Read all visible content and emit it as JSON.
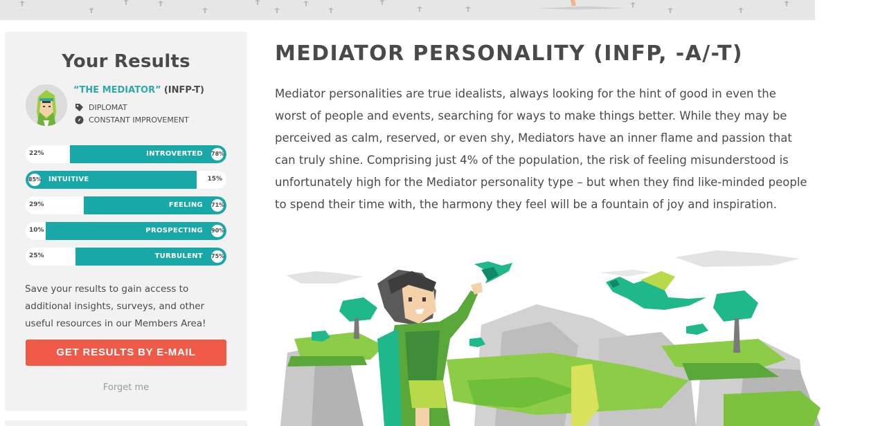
{
  "sidebar": {
    "title": "Your Results",
    "type_name": "“THE MEDIATOR”",
    "type_code": "(INFP-T)",
    "role": "DIPLOMAT",
    "strategy": "CONSTANT IMPROVEMENT",
    "traits": [
      {
        "label": "INTROVERTED",
        "dominant_pct": "78%",
        "other_pct": "22%",
        "dominant_value": 78,
        "side": "right"
      },
      {
        "label": "INTUITIVE",
        "dominant_pct": "85%",
        "other_pct": "15%",
        "dominant_value": 85,
        "side": "left"
      },
      {
        "label": "FEELING",
        "dominant_pct": "71%",
        "other_pct": "29%",
        "dominant_value": 71,
        "side": "right"
      },
      {
        "label": "PROSPECTING",
        "dominant_pct": "90%",
        "other_pct": "10%",
        "dominant_value": 90,
        "side": "right"
      },
      {
        "label": "TURBULENT",
        "dominant_pct": "75%",
        "other_pct": "25%",
        "dominant_value": 75,
        "side": "right"
      }
    ],
    "save_text": "Save your results to gain access to additional insights, surveys, and other useful resources in our Members Area!",
    "email_button": "GET RESULTS BY E-MAIL",
    "forget_link": "Forget me"
  },
  "main": {
    "title": "MEDIATOR PERSONALITY (INFP, -A/-T)",
    "description": "Mediator personalities are true idealists, always looking for the hint of good in even the worst of people and events, searching for ways to make things better. While they may be perceived as calm, reserved, or even shy, Mediators have an inner flame and passion that can truly shine. Comprising just 4% of the population, the risk of feeling misunderstood is unfortunately high for the Mediator personality type – but when they find like-minded people to spend their time with, the harmony they feel will be a fountain of joy and inspiration."
  },
  "colors": {
    "accent": "#18a8a8",
    "accent_text": "#2fa8a6",
    "button": "#ee5a47",
    "panel": "#f2f2f2"
  },
  "icons": {
    "role": "tag-icon",
    "strategy": "compass-icon"
  }
}
